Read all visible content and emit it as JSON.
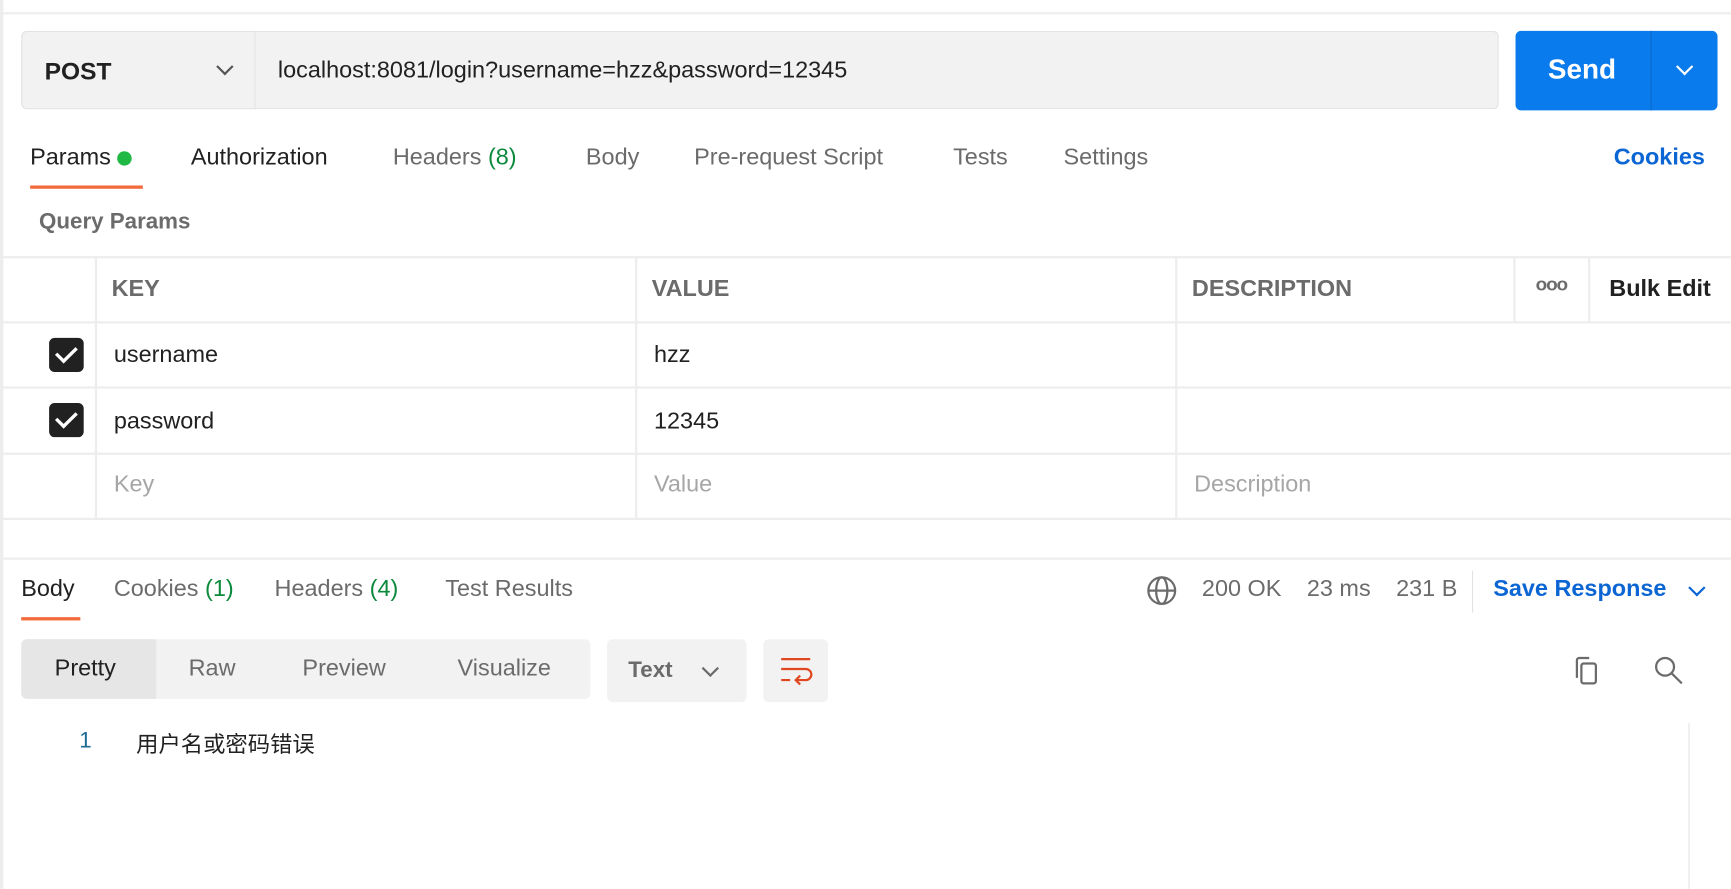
{
  "request": {
    "method": "POST",
    "url": "localhost:8081/login?username=hzz&password=12345",
    "send_label": "Send"
  },
  "tabs": [
    {
      "label": "Params"
    },
    {
      "label": "Authorization"
    },
    {
      "label": "Headers",
      "count": "(8)"
    },
    {
      "label": "Body"
    },
    {
      "label": "Pre-request Script"
    },
    {
      "label": "Tests"
    },
    {
      "label": "Settings"
    }
  ],
  "cookies_link": "Cookies",
  "query_params": {
    "title": "Query Params",
    "columns": [
      "KEY",
      "VALUE",
      "DESCRIPTION"
    ],
    "more": "ooo",
    "bulk_edit": "Bulk Edit",
    "rows": [
      {
        "key": "username",
        "value": "hzz",
        "checked": true
      },
      {
        "key": "password",
        "value": "12345",
        "checked": true
      }
    ],
    "placeholders": {
      "key": "Key",
      "value": "Value",
      "description": "Description"
    }
  },
  "response": {
    "tabs": [
      {
        "label": "Body"
      },
      {
        "label": "Cookies",
        "count": "(1)"
      },
      {
        "label": "Headers",
        "count": "(4)"
      },
      {
        "label": "Test Results"
      }
    ],
    "status": "200 OK",
    "time": "23 ms",
    "size": "231 B",
    "save_label": "Save Response",
    "views": [
      "Pretty",
      "Raw",
      "Preview",
      "Visualize"
    ],
    "format": "Text",
    "lines": [
      {
        "number": "1",
        "text": "用户名或密码错误"
      }
    ]
  },
  "colors": {
    "accent": "#097bed",
    "tab_underline": "#f26b3a",
    "status_green": "#0b8a3c",
    "params_dot": "#1fb944"
  }
}
